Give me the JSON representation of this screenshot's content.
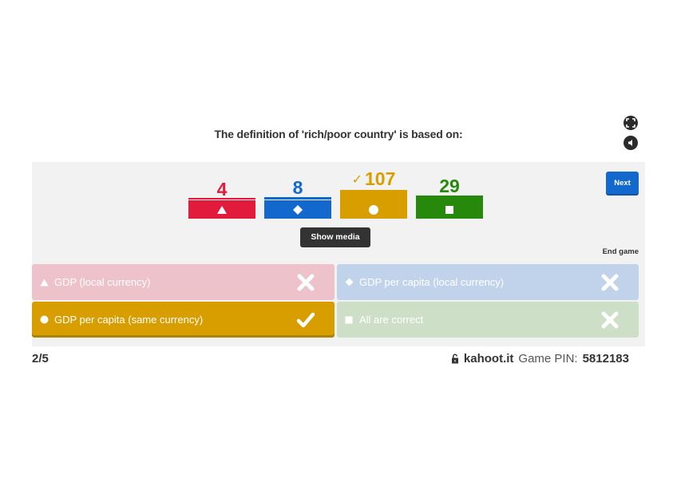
{
  "question": {
    "text": "The definition of 'rich/poor country' is based on:"
  },
  "controls": {
    "fullscreen_icon": "expand-icon",
    "sound_icon": "speaker-icon"
  },
  "results": [
    {
      "count": "4",
      "color": "#e21b3c",
      "shape": "triangle",
      "correct": false
    },
    {
      "count": "8",
      "color": "#1368ce",
      "shape": "diamond",
      "correct": false
    },
    {
      "count": "107",
      "color": "#d89e00",
      "shape": "circle",
      "correct": true,
      "check": "✓"
    },
    {
      "count": "29",
      "color": "#26890c",
      "shape": "square",
      "correct": false
    }
  ],
  "buttons": {
    "show_media": "Show media",
    "next": "Next",
    "end_game": "End game"
  },
  "answers": [
    {
      "label": "GDP (local currency)",
      "shape": "triangle",
      "correct": false
    },
    {
      "label": "GDP per capita (local currency)",
      "shape": "diamond",
      "correct": false
    },
    {
      "label": "GDP per capita (same currency)",
      "shape": "circle",
      "correct": true
    },
    {
      "label": "All are correct",
      "shape": "square",
      "correct": false
    }
  ],
  "footer": {
    "progress": "2/5",
    "domain": "kahoot.it",
    "pin_label": "Game PIN:",
    "pin": "5812183",
    "lock_icon": "lock-icon"
  }
}
